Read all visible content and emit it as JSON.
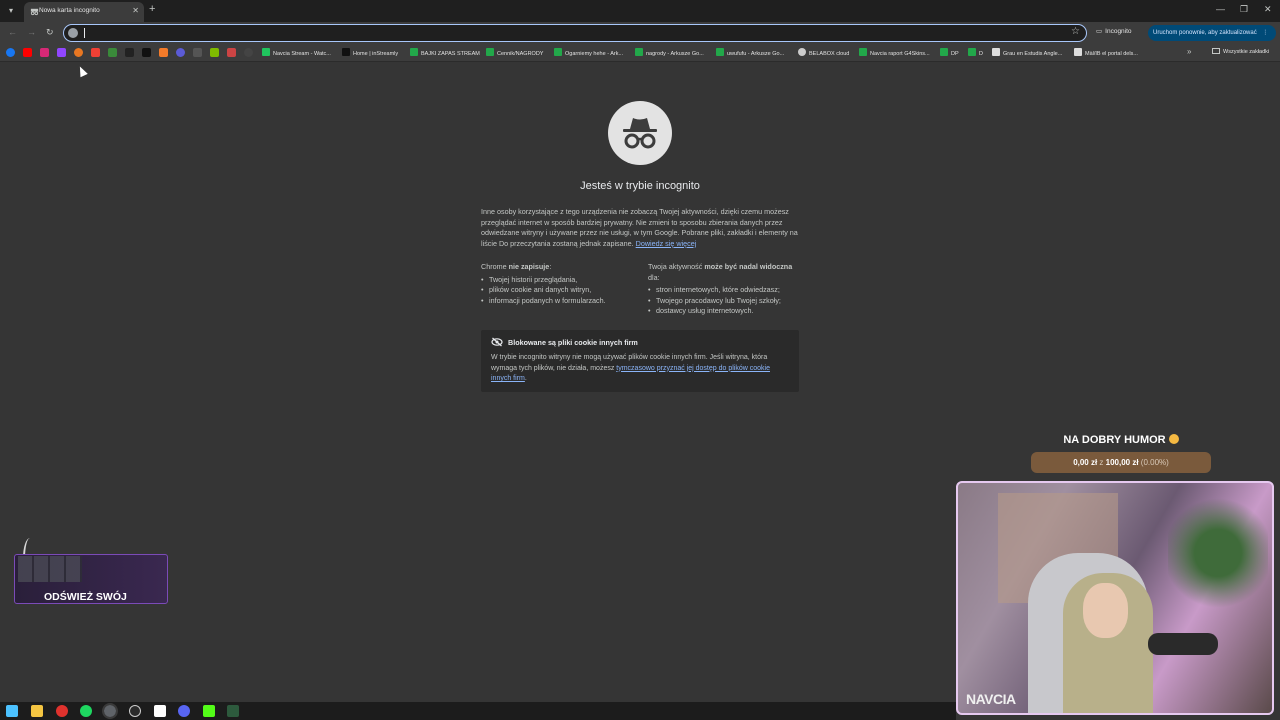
{
  "tab": {
    "title": "Nowa karta incognito",
    "close": "✕"
  },
  "newtab": "+",
  "window_controls": {
    "minimize": "—",
    "restore": "❐",
    "close": "✕"
  },
  "nav": {
    "back": "←",
    "forward": "→",
    "reload": "↻"
  },
  "omnibox": {
    "value": "",
    "star": "☆"
  },
  "incognito_chip": "Incognito",
  "update_button": "Uruchom ponownie, aby zaktualizować",
  "bookmarks": [
    {
      "label": "Navcia Stream - Watc...",
      "color": "#20c55e"
    },
    {
      "label": "Home | inStreamly",
      "color": "#111111"
    },
    {
      "label": "BAJKI ZAPAS STREAM",
      "color": "#22a84a"
    },
    {
      "label": "Cennik/NAGRODY",
      "color": "#22a84a"
    },
    {
      "label": "Ogarniemy hehe - Ark...",
      "color": "#22a84a"
    },
    {
      "label": "nagrody - Arkusze Go...",
      "color": "#22a84a"
    },
    {
      "label": "uwufufu - Arkusze Go...",
      "color": "#22a84a"
    },
    {
      "label": "BELABOX cloud",
      "color": "#cccccc"
    },
    {
      "label": "Navcia raport G4Skins...",
      "color": "#22a84a"
    },
    {
      "label": "DP",
      "color": "#22a84a"
    },
    {
      "label": "D",
      "color": "#22a84a"
    },
    {
      "label": "Grau en Estudis Angle...",
      "color": "#dddddd"
    },
    {
      "label": "Màl/IB el portal dels...",
      "color": "#dddddd"
    }
  ],
  "bookmarks_more": "»",
  "all_bookmarks": "Wszystkie zakładki",
  "incognito_page": {
    "heading": "Jesteś w trybie incognito",
    "paragraph": "Inne osoby korzystające z tego urządzenia nie zobaczą Twojej aktywności, dzięki czemu możesz przeglądać internet w sposób bardziej prywatny. Nie zmieni to sposobu zbierania danych przez odwiedzane witryny i używane przez nie usługi, w tym Google. Pobrane pliki, zakładki i elementy na liście Do przeczytania zostaną jednak zapisane.",
    "learn_more": "Dowiedz się więcej",
    "chrome_prefix": "Chrome ",
    "chrome_strong": "nie zapisuje",
    "chrome_suffix": ":",
    "chrome_items": [
      "Twojej historii przeglądania,",
      "plików cookie ani danych witryn,",
      "informacji podanych w formularzach."
    ],
    "visible_prefix": "Twoja aktywność ",
    "visible_strong": "może być nadal widoczna",
    "visible_suffix": " dla:",
    "visible_items": [
      "stron internetowych, które odwiedzasz;",
      "Twojego pracodawcy lub Twojej szkoły;",
      "dostawcy usług internetowych."
    ],
    "cookie_title": "Blokowane są pliki cookie innych firm",
    "cookie_text": "W trybie incognito witryny nie mogą używać plików cookie innych firm. Jeśli witryna, która wymaga tych plików, nie działa, możesz ",
    "cookie_link": "tymczasowo przyznać jej dostęp do plików cookie innych firm",
    "cookie_end": "."
  },
  "goal": {
    "title": "NA DOBRY HUMOR",
    "amount_current": "0,00 zł",
    "amount_sep": " z ",
    "amount_target": "100,00 zł",
    "percent": " (0.00%)"
  },
  "refresh_widget": {
    "label": "ODŚWIEŻ SWÓJ"
  },
  "webcam": {
    "name": "NAVCIA"
  }
}
